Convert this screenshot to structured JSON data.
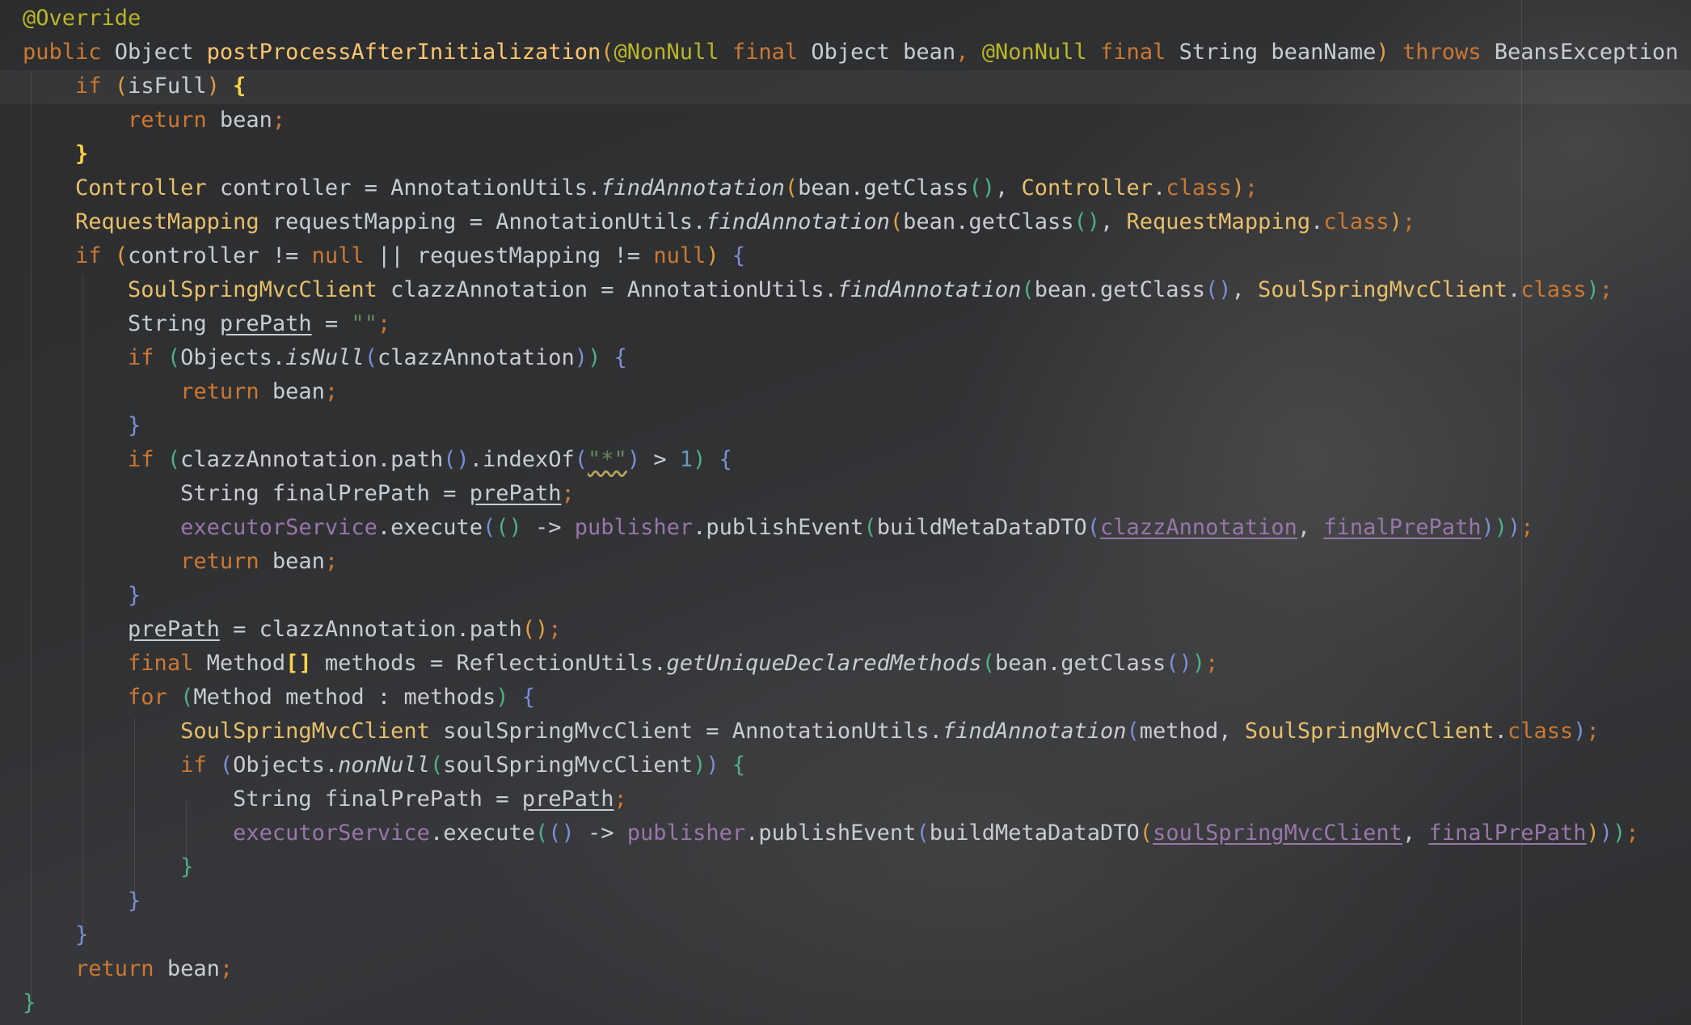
{
  "colors": {
    "keyword": "#cc7832",
    "annotation": "#bbb529",
    "function_decl": "#ffc66d",
    "class_name": "#e8bf6a",
    "field": "#9876aa",
    "string": "#6a8759",
    "number": "#6897bb",
    "default_text": "#c9ccd3"
  },
  "lines": [
    [
      {
        "t": "@Override",
        "c": "ann"
      }
    ],
    [
      {
        "t": "public",
        "c": "kw"
      },
      {
        "t": " Object "
      },
      {
        "t": "postProcessAfterInitialization",
        "c": "fn"
      },
      {
        "t": "(",
        "c": "br4"
      },
      {
        "t": "@NonNull",
        "c": "ann"
      },
      {
        "t": " "
      },
      {
        "t": "final",
        "c": "kw"
      },
      {
        "t": " Object bean"
      },
      {
        "t": ",",
        "c": "semi"
      },
      {
        "t": " "
      },
      {
        "t": "@NonNull",
        "c": "ann"
      },
      {
        "t": " "
      },
      {
        "t": "final",
        "c": "kw"
      },
      {
        "t": " String beanName"
      },
      {
        "t": ")",
        "c": "br4"
      },
      {
        "t": " "
      },
      {
        "t": "throws",
        "c": "kw"
      },
      {
        "t": " BeansException "
      },
      {
        "t": "{",
        "c": "br4"
      }
    ],
    [
      {
        "t": "    "
      },
      {
        "t": "if",
        "c": "kw"
      },
      {
        "t": " "
      },
      {
        "t": "(",
        "c": "br4"
      },
      {
        "t": "isFull"
      },
      {
        "t": ")",
        "c": "br4"
      },
      {
        "t": " "
      },
      {
        "t": "{",
        "c": "br1"
      }
    ],
    [
      {
        "t": "        "
      },
      {
        "t": "return",
        "c": "kw"
      },
      {
        "t": " bean"
      },
      {
        "t": ";",
        "c": "semi"
      }
    ],
    [
      {
        "t": "    "
      },
      {
        "t": "}",
        "c": "br1"
      }
    ],
    [
      {
        "t": "    "
      },
      {
        "t": "Controller",
        "c": "cls"
      },
      {
        "t": " controller = AnnotationUtils."
      },
      {
        "t": "findAnnotation",
        "c": "it"
      },
      {
        "t": "(",
        "c": "br4"
      },
      {
        "t": "bean.getClass"
      },
      {
        "t": "()",
        "c": "br3"
      },
      {
        "t": ","
      },
      {
        "t": " "
      },
      {
        "t": "Controller",
        "c": "cls"
      },
      {
        "t": "."
      },
      {
        "t": "class",
        "c": "kw"
      },
      {
        "t": ")",
        "c": "br4"
      },
      {
        "t": ";",
        "c": "semi"
      }
    ],
    [
      {
        "t": "    "
      },
      {
        "t": "RequestMapping",
        "c": "cls"
      },
      {
        "t": " requestMapping = AnnotationUtils."
      },
      {
        "t": "findAnnotation",
        "c": "it"
      },
      {
        "t": "(",
        "c": "br4"
      },
      {
        "t": "bean.getClass"
      },
      {
        "t": "()",
        "c": "br3"
      },
      {
        "t": ","
      },
      {
        "t": " "
      },
      {
        "t": "RequestMapping",
        "c": "cls"
      },
      {
        "t": "."
      },
      {
        "t": "class",
        "c": "kw"
      },
      {
        "t": ")",
        "c": "br4"
      },
      {
        "t": ";",
        "c": "semi"
      }
    ],
    [
      {
        "t": "    "
      },
      {
        "t": "if",
        "c": "kw"
      },
      {
        "t": " "
      },
      {
        "t": "(",
        "c": "br4"
      },
      {
        "t": "controller != "
      },
      {
        "t": "null",
        "c": "kw"
      },
      {
        "t": " || requestMapping != "
      },
      {
        "t": "null",
        "c": "kw"
      },
      {
        "t": ")",
        "c": "br4"
      },
      {
        "t": " "
      },
      {
        "t": "{",
        "c": "br2"
      }
    ],
    [
      {
        "t": "        "
      },
      {
        "t": "SoulSpringMvcClient",
        "c": "cls"
      },
      {
        "t": " clazzAnnotation = AnnotationUtils."
      },
      {
        "t": "findAnnotation",
        "c": "it"
      },
      {
        "t": "(",
        "c": "br3"
      },
      {
        "t": "bean.getClass"
      },
      {
        "t": "()",
        "c": "br2"
      },
      {
        "t": ","
      },
      {
        "t": " "
      },
      {
        "t": "SoulSpringMvcClient",
        "c": "cls"
      },
      {
        "t": "."
      },
      {
        "t": "class",
        "c": "kw"
      },
      {
        "t": ")",
        "c": "br3"
      },
      {
        "t": ";",
        "c": "semi"
      }
    ],
    [
      {
        "t": "        String "
      },
      {
        "t": "prePath",
        "c": "ul"
      },
      {
        "t": " = "
      },
      {
        "t": "\"\"",
        "c": "str"
      },
      {
        "t": ";",
        "c": "semi"
      }
    ],
    [
      {
        "t": "        "
      },
      {
        "t": "if",
        "c": "kw"
      },
      {
        "t": " "
      },
      {
        "t": "(",
        "c": "br3"
      },
      {
        "t": "Objects."
      },
      {
        "t": "isNull",
        "c": "it"
      },
      {
        "t": "(",
        "c": "br2"
      },
      {
        "t": "clazzAnnotation"
      },
      {
        "t": ")",
        "c": "br2"
      },
      {
        "t": ")",
        "c": "br3"
      },
      {
        "t": " "
      },
      {
        "t": "{",
        "c": "br2"
      }
    ],
    [
      {
        "t": "            "
      },
      {
        "t": "return",
        "c": "kw"
      },
      {
        "t": " bean"
      },
      {
        "t": ";",
        "c": "semi"
      }
    ],
    [
      {
        "t": "        "
      },
      {
        "t": "}",
        "c": "br2"
      }
    ],
    [
      {
        "t": "        "
      },
      {
        "t": "if",
        "c": "kw"
      },
      {
        "t": " "
      },
      {
        "t": "(",
        "c": "br3"
      },
      {
        "t": "clazzAnnotation.path"
      },
      {
        "t": "()",
        "c": "br2"
      },
      {
        "t": ".indexOf"
      },
      {
        "t": "(",
        "c": "br2"
      },
      {
        "t": "\"*\"",
        "c": "str squig"
      },
      {
        "t": ")",
        "c": "br2"
      },
      {
        "t": " > "
      },
      {
        "t": "1",
        "c": "num"
      },
      {
        "t": ")",
        "c": "br3"
      },
      {
        "t": " "
      },
      {
        "t": "{",
        "c": "br2"
      }
    ],
    [
      {
        "t": "            String finalPrePath = "
      },
      {
        "t": "prePath",
        "c": "ul"
      },
      {
        "t": ";",
        "c": "semi"
      }
    ],
    [
      {
        "t": "            "
      },
      {
        "t": "executorService",
        "c": "fld"
      },
      {
        "t": ".execute"
      },
      {
        "t": "(",
        "c": "br2"
      },
      {
        "t": "()",
        "c": "br3"
      },
      {
        "t": " -> "
      },
      {
        "t": "publisher",
        "c": "fld"
      },
      {
        "t": ".publishEvent"
      },
      {
        "t": "(",
        "c": "br3"
      },
      {
        "t": "buildMetaDataDTO"
      },
      {
        "t": "(",
        "c": "br2"
      },
      {
        "t": "clazzAnnotation",
        "c": "fld ul"
      },
      {
        "t": ", "
      },
      {
        "t": "finalPrePath",
        "c": "fld ul"
      },
      {
        "t": ")",
        "c": "br2"
      },
      {
        "t": ")",
        "c": "br3"
      },
      {
        "t": ")",
        "c": "br2"
      },
      {
        "t": ";",
        "c": "semi"
      }
    ],
    [
      {
        "t": "            "
      },
      {
        "t": "return",
        "c": "kw"
      },
      {
        "t": " bean"
      },
      {
        "t": ";",
        "c": "semi"
      }
    ],
    [
      {
        "t": "        "
      },
      {
        "t": "}",
        "c": "br2"
      }
    ],
    [
      {
        "t": "        "
      },
      {
        "t": "prePath",
        "c": "ul"
      },
      {
        "t": " = clazzAnnotation.path"
      },
      {
        "t": "()",
        "c": "br4"
      },
      {
        "t": ";",
        "c": "semi"
      }
    ],
    [
      {
        "t": "        "
      },
      {
        "t": "final",
        "c": "kw"
      },
      {
        "t": " Method"
      },
      {
        "t": "[]",
        "c": "br1"
      },
      {
        "t": " methods = ReflectionUtils."
      },
      {
        "t": "getUniqueDeclaredMethods",
        "c": "it"
      },
      {
        "t": "(",
        "c": "br3"
      },
      {
        "t": "bean.getClass"
      },
      {
        "t": "()",
        "c": "br2"
      },
      {
        "t": ")",
        "c": "br3"
      },
      {
        "t": ";",
        "c": "semi"
      }
    ],
    [
      {
        "t": "        "
      },
      {
        "t": "for",
        "c": "kw"
      },
      {
        "t": " "
      },
      {
        "t": "(",
        "c": "br3"
      },
      {
        "t": "Method method : methods"
      },
      {
        "t": ")",
        "c": "br3"
      },
      {
        "t": " "
      },
      {
        "t": "{",
        "c": "br2"
      }
    ],
    [
      {
        "t": "            "
      },
      {
        "t": "SoulSpringMvcClient",
        "c": "cls"
      },
      {
        "t": " soulSpringMvcClient = AnnotationUtils."
      },
      {
        "t": "findAnnotation",
        "c": "it"
      },
      {
        "t": "(",
        "c": "br2"
      },
      {
        "t": "method"
      },
      {
        "t": ", "
      },
      {
        "t": "SoulSpringMvcClient",
        "c": "cls"
      },
      {
        "t": "."
      },
      {
        "t": "class",
        "c": "kw"
      },
      {
        "t": ")",
        "c": "br2"
      },
      {
        "t": ";",
        "c": "semi"
      }
    ],
    [
      {
        "t": "            "
      },
      {
        "t": "if",
        "c": "kw"
      },
      {
        "t": " "
      },
      {
        "t": "(",
        "c": "br2"
      },
      {
        "t": "Objects."
      },
      {
        "t": "nonNull",
        "c": "it"
      },
      {
        "t": "(",
        "c": "br3"
      },
      {
        "t": "soulSpringMvcClient"
      },
      {
        "t": ")",
        "c": "br3"
      },
      {
        "t": ")",
        "c": "br2"
      },
      {
        "t": " "
      },
      {
        "t": "{",
        "c": "br3"
      }
    ],
    [
      {
        "t": "                String finalPrePath = "
      },
      {
        "t": "prePath",
        "c": "ul"
      },
      {
        "t": ";",
        "c": "semi"
      }
    ],
    [
      {
        "t": "                "
      },
      {
        "t": "executorService",
        "c": "fld"
      },
      {
        "t": ".execute"
      },
      {
        "t": "(",
        "c": "br3"
      },
      {
        "t": "()",
        "c": "br2"
      },
      {
        "t": " -> "
      },
      {
        "t": "publisher",
        "c": "fld"
      },
      {
        "t": ".publishEvent"
      },
      {
        "t": "(",
        "c": "br2"
      },
      {
        "t": "buildMetaDataDTO"
      },
      {
        "t": "(",
        "c": "br4"
      },
      {
        "t": "soulSpringMvcClient",
        "c": "fld ul"
      },
      {
        "t": ", "
      },
      {
        "t": "finalPrePath",
        "c": "fld ul"
      },
      {
        "t": ")",
        "c": "br4"
      },
      {
        "t": ")",
        "c": "br2"
      },
      {
        "t": ")",
        "c": "br3"
      },
      {
        "t": ";",
        "c": "semi"
      }
    ],
    [
      {
        "t": "            "
      },
      {
        "t": "}",
        "c": "br3"
      }
    ],
    [
      {
        "t": "        "
      },
      {
        "t": "}",
        "c": "br2"
      }
    ],
    [
      {
        "t": "    "
      },
      {
        "t": "}",
        "c": "br2"
      }
    ],
    [
      {
        "t": "    "
      },
      {
        "t": "return",
        "c": "kw"
      },
      {
        "t": " bean"
      },
      {
        "t": ";",
        "c": "semi"
      }
    ],
    [
      {
        "t": "}",
        "c": "br3"
      }
    ]
  ]
}
